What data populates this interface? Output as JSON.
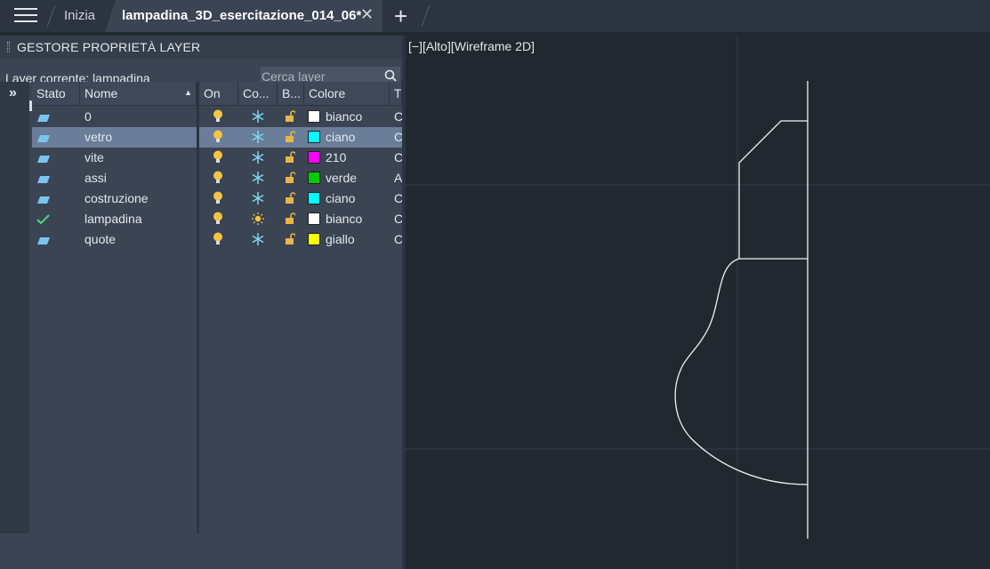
{
  "tabs": {
    "home": "Inizia",
    "active": "lampadina_3D_esercitazione_014_06*"
  },
  "palette": {
    "title": "GESTORE PROPRIETÀ LAYER",
    "current_layer": "Layer corrente: lampadina",
    "search_placeholder": "Cerca layer",
    "headers": {
      "stato": "Stato",
      "nome": "Nome",
      "on": "On",
      "congela": "Co...",
      "blocca": "B...",
      "colore": "Colore",
      "tipo": "T"
    },
    "layers": [
      {
        "name": "0",
        "status": "layer-icon",
        "color_name": "bianco",
        "color_hex": "#ffffff",
        "freeze": "snowflake-icon",
        "tipo": "C"
      },
      {
        "name": "vetro",
        "status": "layer-icon",
        "color_name": "ciano",
        "color_hex": "#00ffff",
        "freeze": "snowflake-icon",
        "tipo": "C",
        "selected": true
      },
      {
        "name": "vite",
        "status": "layer-icon",
        "color_name": "210",
        "color_hex": "#ff00ff",
        "freeze": "snowflake-icon",
        "tipo": "C"
      },
      {
        "name": "assi",
        "status": "layer-icon",
        "color_name": "verde",
        "color_hex": "#00cc00",
        "freeze": "snowflake-icon",
        "tipo": "A"
      },
      {
        "name": "costruzione",
        "status": "layer-icon",
        "color_name": "ciano",
        "color_hex": "#00ffff",
        "freeze": "snowflake-icon",
        "tipo": "C"
      },
      {
        "name": "lampadina",
        "status": "check-icon",
        "color_name": "bianco",
        "color_hex": "#ffffff",
        "freeze": "sun-icon",
        "tipo": "C"
      },
      {
        "name": "quote",
        "status": "layer-icon",
        "color_name": "giallo",
        "color_hex": "#ffff00",
        "freeze": "snowflake-icon",
        "tipo": "C"
      }
    ]
  },
  "viewport": {
    "label": "[−][Alto][Wireframe 2D]"
  },
  "colors": {
    "accent_selected": "#6a7d99",
    "bulb": "#f5c542",
    "lock": "#e8b54a",
    "snowflake": "#7fd7f0"
  }
}
